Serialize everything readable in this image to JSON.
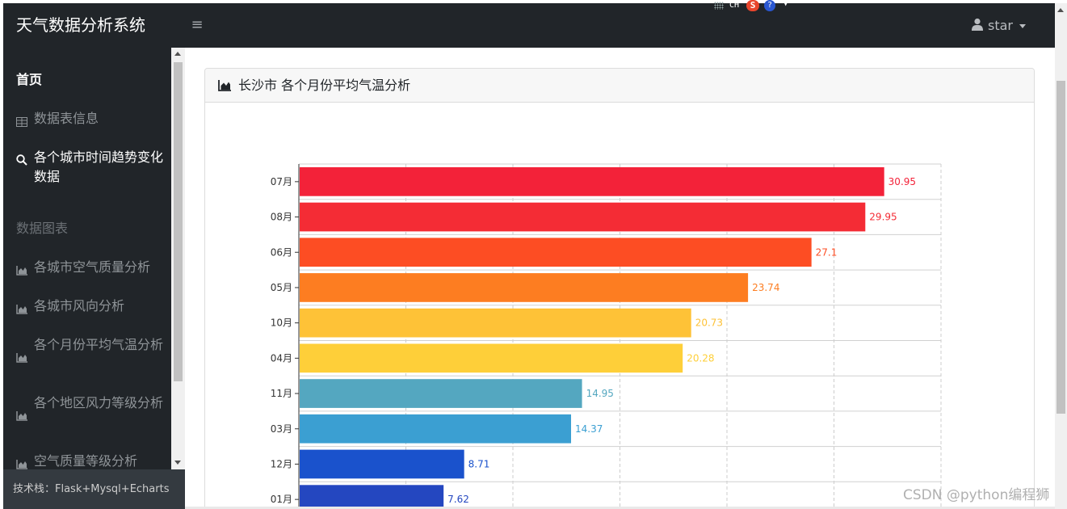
{
  "app": {
    "brand": "天气数据分析系统",
    "menu_toggle": "≡",
    "user": "star"
  },
  "ime": {
    "lang": "CH",
    "logo": "S",
    "help": "?"
  },
  "sidebar": {
    "home": "首页",
    "items_top": [
      {
        "label": "数据表信息",
        "icon": "table-icon"
      },
      {
        "label": "各个城市时间趋势变化数据",
        "icon": "search-icon"
      }
    ],
    "section_heading": "数据图表",
    "chart_items": [
      {
        "label": "各城市空气质量分析",
        "icon": "area-chart-icon"
      },
      {
        "label": "各城市风向分析",
        "icon": "area-chart-icon"
      },
      {
        "label": "各个月份平均气温分析",
        "icon": "area-chart-icon"
      },
      {
        "label": "各个地区风力等级分析",
        "icon": "area-chart-icon"
      },
      {
        "label": "空气质量等级分析",
        "icon": "area-chart-icon"
      }
    ],
    "footer": "技术栈：Flask+Mysql+Echarts"
  },
  "card": {
    "title": "长沙市 各个月份平均气温分析"
  },
  "chart_data": {
    "type": "bar",
    "orientation": "horizontal",
    "categories": [
      "07月",
      "08月",
      "06月",
      "05月",
      "10月",
      "04月",
      "11月",
      "03月",
      "12月",
      "01月"
    ],
    "values": [
      30.95,
      29.95,
      27.1,
      23.74,
      20.73,
      20.28,
      14.95,
      14.37,
      8.71,
      7.62
    ],
    "labels": [
      "30.95",
      "29.95",
      "27.1",
      "23.74",
      "20.73",
      "20.28",
      "14.95",
      "14.37",
      "8.71",
      "7.62"
    ],
    "colors": [
      "#f32239",
      "#f42c35",
      "#fd4d23",
      "#fd7d21",
      "#fec237",
      "#fecf39",
      "#54a7c0",
      "#3b9fd2",
      "#1a52cc",
      "#2447c0"
    ],
    "xlim": [
      0,
      34
    ],
    "grid": true,
    "xlabel": "",
    "ylabel": ""
  },
  "watermark": "CSDN @python编程狮"
}
